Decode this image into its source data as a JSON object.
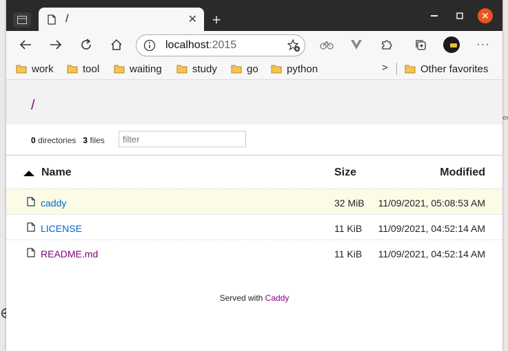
{
  "browser": {
    "tab_title": "/",
    "address_host": "localhost",
    "address_port": ":2015",
    "bookmarks": [
      "work",
      "tool",
      "waiting",
      "study",
      "go",
      "python"
    ],
    "other_favorites": "Other favorites"
  },
  "listing": {
    "path": "/",
    "dir_count": "0",
    "dir_label": "directories",
    "file_count": "3",
    "file_label": "files",
    "filter_placeholder": "filter",
    "columns": {
      "name": "Name",
      "size": "Size",
      "modified": "Modified"
    },
    "files": [
      {
        "name": "caddy",
        "size": "32 MiB",
        "modified": "11/09/2021, 05:08:53 AM",
        "color": "#0066cc"
      },
      {
        "name": "LICENSE",
        "size": "11 KiB",
        "modified": "11/09/2021, 04:52:14 AM",
        "color": "#0066cc"
      },
      {
        "name": "README.md",
        "size": "11 KiB",
        "modified": "11/09/2021, 04:52:14 AM",
        "color": "#800080"
      }
    ],
    "footer_prefix": "Served with",
    "footer_link": "Caddy"
  },
  "desktop": {
    "edge_text": "ee"
  }
}
